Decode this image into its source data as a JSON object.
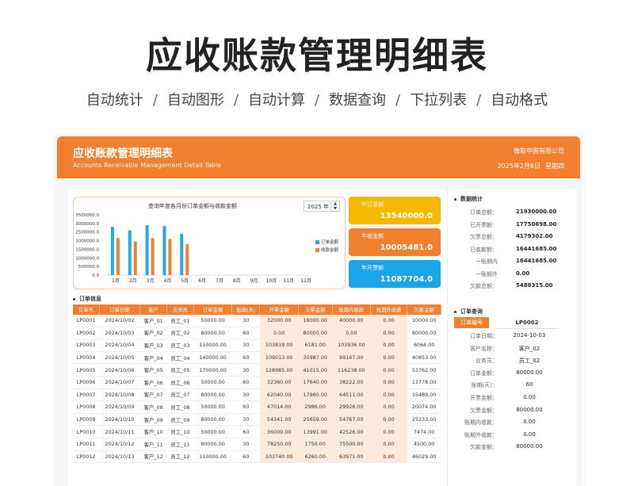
{
  "hero": {
    "title": "应收账款管理明细表",
    "features": [
      "自动统计",
      "自动图形",
      "自动计算",
      "数据查询",
      "下拉列表",
      "自动格式"
    ],
    "separator": "/"
  },
  "banner": {
    "title": "应收账款管理明细表",
    "subtitle": "Accounts Receivable Management Detail Table",
    "company": "微软中国有限公司",
    "date": "2025年2月6日",
    "weekday": "星期四"
  },
  "chart_data": {
    "type": "bar",
    "title": "查询年度各月份订单金额与收款金额",
    "year": "2025 年",
    "categories": [
      "1月",
      "2月",
      "3月",
      "4月",
      "5月",
      "6月",
      "7月",
      "8月",
      "9月",
      "10月",
      "11月",
      "12月"
    ],
    "ylim": [
      0,
      3500000
    ],
    "yticks": [
      "3500000.0",
      "3000000.0",
      "2500000.0",
      "2000000.0",
      "1500000.0",
      "1000000.0",
      "500000.0",
      "0.0"
    ],
    "series": [
      {
        "name": "订单金额",
        "color": "#29a8e0",
        "values": [
          2800000,
          2600000,
          2900000,
          2850000,
          2400000,
          0,
          0,
          0,
          0,
          0,
          0,
          0
        ]
      },
      {
        "name": "收款金额",
        "color": "#f08030",
        "values": [
          2150000,
          1950000,
          2150000,
          2100000,
          1800000,
          0,
          0,
          0,
          0,
          0,
          0,
          0
        ]
      }
    ]
  },
  "kpis": [
    {
      "label": "年订单额",
      "value": "13540000.0",
      "color": "#f6b800"
    },
    {
      "label": "年收金额",
      "value": "10005481.0",
      "color": "#f08030"
    },
    {
      "label": "年开票额",
      "value": "11087704.0",
      "color": "#1aa6e6"
    }
  ],
  "orders": {
    "section": "订单信息",
    "headers": [
      "订单号",
      "订单日期",
      "客户",
      "业务员",
      "订单金额",
      "账期(天)",
      "开票金额",
      "欠票金额",
      "账期内收款",
      "账期外收款",
      "欠款金额"
    ],
    "rows": [
      [
        "LP0001",
        "2024/10/02",
        "客户_01",
        "员工_01",
        "50000.00",
        "30",
        "32000.00",
        "18000.00",
        "40000.00",
        "0.00",
        "10000.00"
      ],
      [
        "LP0002",
        "2024/10/03",
        "客户_02",
        "员工_02",
        "80000.00",
        "60",
        "0.00",
        "80000.00",
        "0.00",
        "0.00",
        "80000.00"
      ],
      [
        "LP0003",
        "2024/10/04",
        "客户_03",
        "员工_03",
        "110000.00",
        "30",
        "103819.00",
        "6181.00",
        "103936.00",
        "0.00",
        "6064.00"
      ],
      [
        "LP0004",
        "2024/10/05",
        "客户_04",
        "员工_04",
        "140000.00",
        "60",
        "109013.00",
        "30987.00",
        "99147.00",
        "0.00",
        "40853.00"
      ],
      [
        "LP0005",
        "2024/10/06",
        "客户_05",
        "员工_05",
        "170000.00",
        "30",
        "128985.00",
        "41015.00",
        "116238.00",
        "0.00",
        "53762.00"
      ],
      [
        "LP0006",
        "2024/10/07",
        "客户_06",
        "员工_06",
        "50000.00",
        "60",
        "32360.00",
        "17640.00",
        "38222.00",
        "0.00",
        "11778.00"
      ],
      [
        "LP0007",
        "2024/10/08",
        "客户_07",
        "员工_07",
        "80000.00",
        "30",
        "62040.00",
        "17960.00",
        "64511.00",
        "0.00",
        "15489.00"
      ],
      [
        "LP0008",
        "2024/10/09",
        "客户_08",
        "员工_08",
        "50000.00",
        "60",
        "47014.00",
        "2986.00",
        "29926.00",
        "0.00",
        "20074.00"
      ],
      [
        "LP0009",
        "2024/10/10",
        "客户_09",
        "员工_09",
        "80000.00",
        "30",
        "54341.00",
        "25659.00",
        "54767.00",
        "0.00",
        "25233.00"
      ],
      [
        "LP0010",
        "2024/10/11",
        "客户_10",
        "员工_10",
        "50000.00",
        "60",
        "36009.00",
        "13991.00",
        "42526.00",
        "0.00",
        "7474.00"
      ],
      [
        "LP0011",
        "2024/10/12",
        "客户_11",
        "员工_11",
        "80000.00",
        "30",
        "78250.00",
        "1750.00",
        "75500.00",
        "0.00",
        "4500.00"
      ],
      [
        "LP0012",
        "2024/10/13",
        "客户_12",
        "员工_12",
        "110000.00",
        "60",
        "103740.00",
        "6260.00",
        "63971.00",
        "0.00",
        "46029.00"
      ]
    ]
  },
  "stats": {
    "section": "数据统计",
    "items": [
      {
        "label": "订单总额：",
        "value": "21930000.00"
      },
      {
        "label": "已开票额：",
        "value": "17750698.00"
      },
      {
        "label": "欠票总额：",
        "value": "4179302.00"
      },
      {
        "label": "已收款额：",
        "value": "16441685.00"
      },
      {
        "label": "一账期内",
        "value": "16441685.00"
      },
      {
        "label": "一账期外",
        "value": "0.00"
      },
      {
        "label": "欠款总额：",
        "value": "5488315.00"
      }
    ]
  },
  "query": {
    "section": "订单查询",
    "key_label": "订单编号",
    "key_value": "LP0002",
    "items": [
      {
        "label": "订单日期：",
        "value": "2024-10-03"
      },
      {
        "label": "客户名称：",
        "value": "客户_02"
      },
      {
        "label": "业务员：",
        "value": "员工_02"
      },
      {
        "label": "订单金额：",
        "value": "80000.00"
      },
      {
        "label": "账期(天)：",
        "value": "60"
      },
      {
        "label": "开票金额：",
        "value": "0.00"
      },
      {
        "label": "欠票金额：",
        "value": "80000.00"
      },
      {
        "label": "账期内收款：",
        "value": "0.00"
      },
      {
        "label": "账期外收款：",
        "value": "0.00"
      },
      {
        "label": "欠款金额：",
        "value": "80000.00"
      }
    ]
  }
}
